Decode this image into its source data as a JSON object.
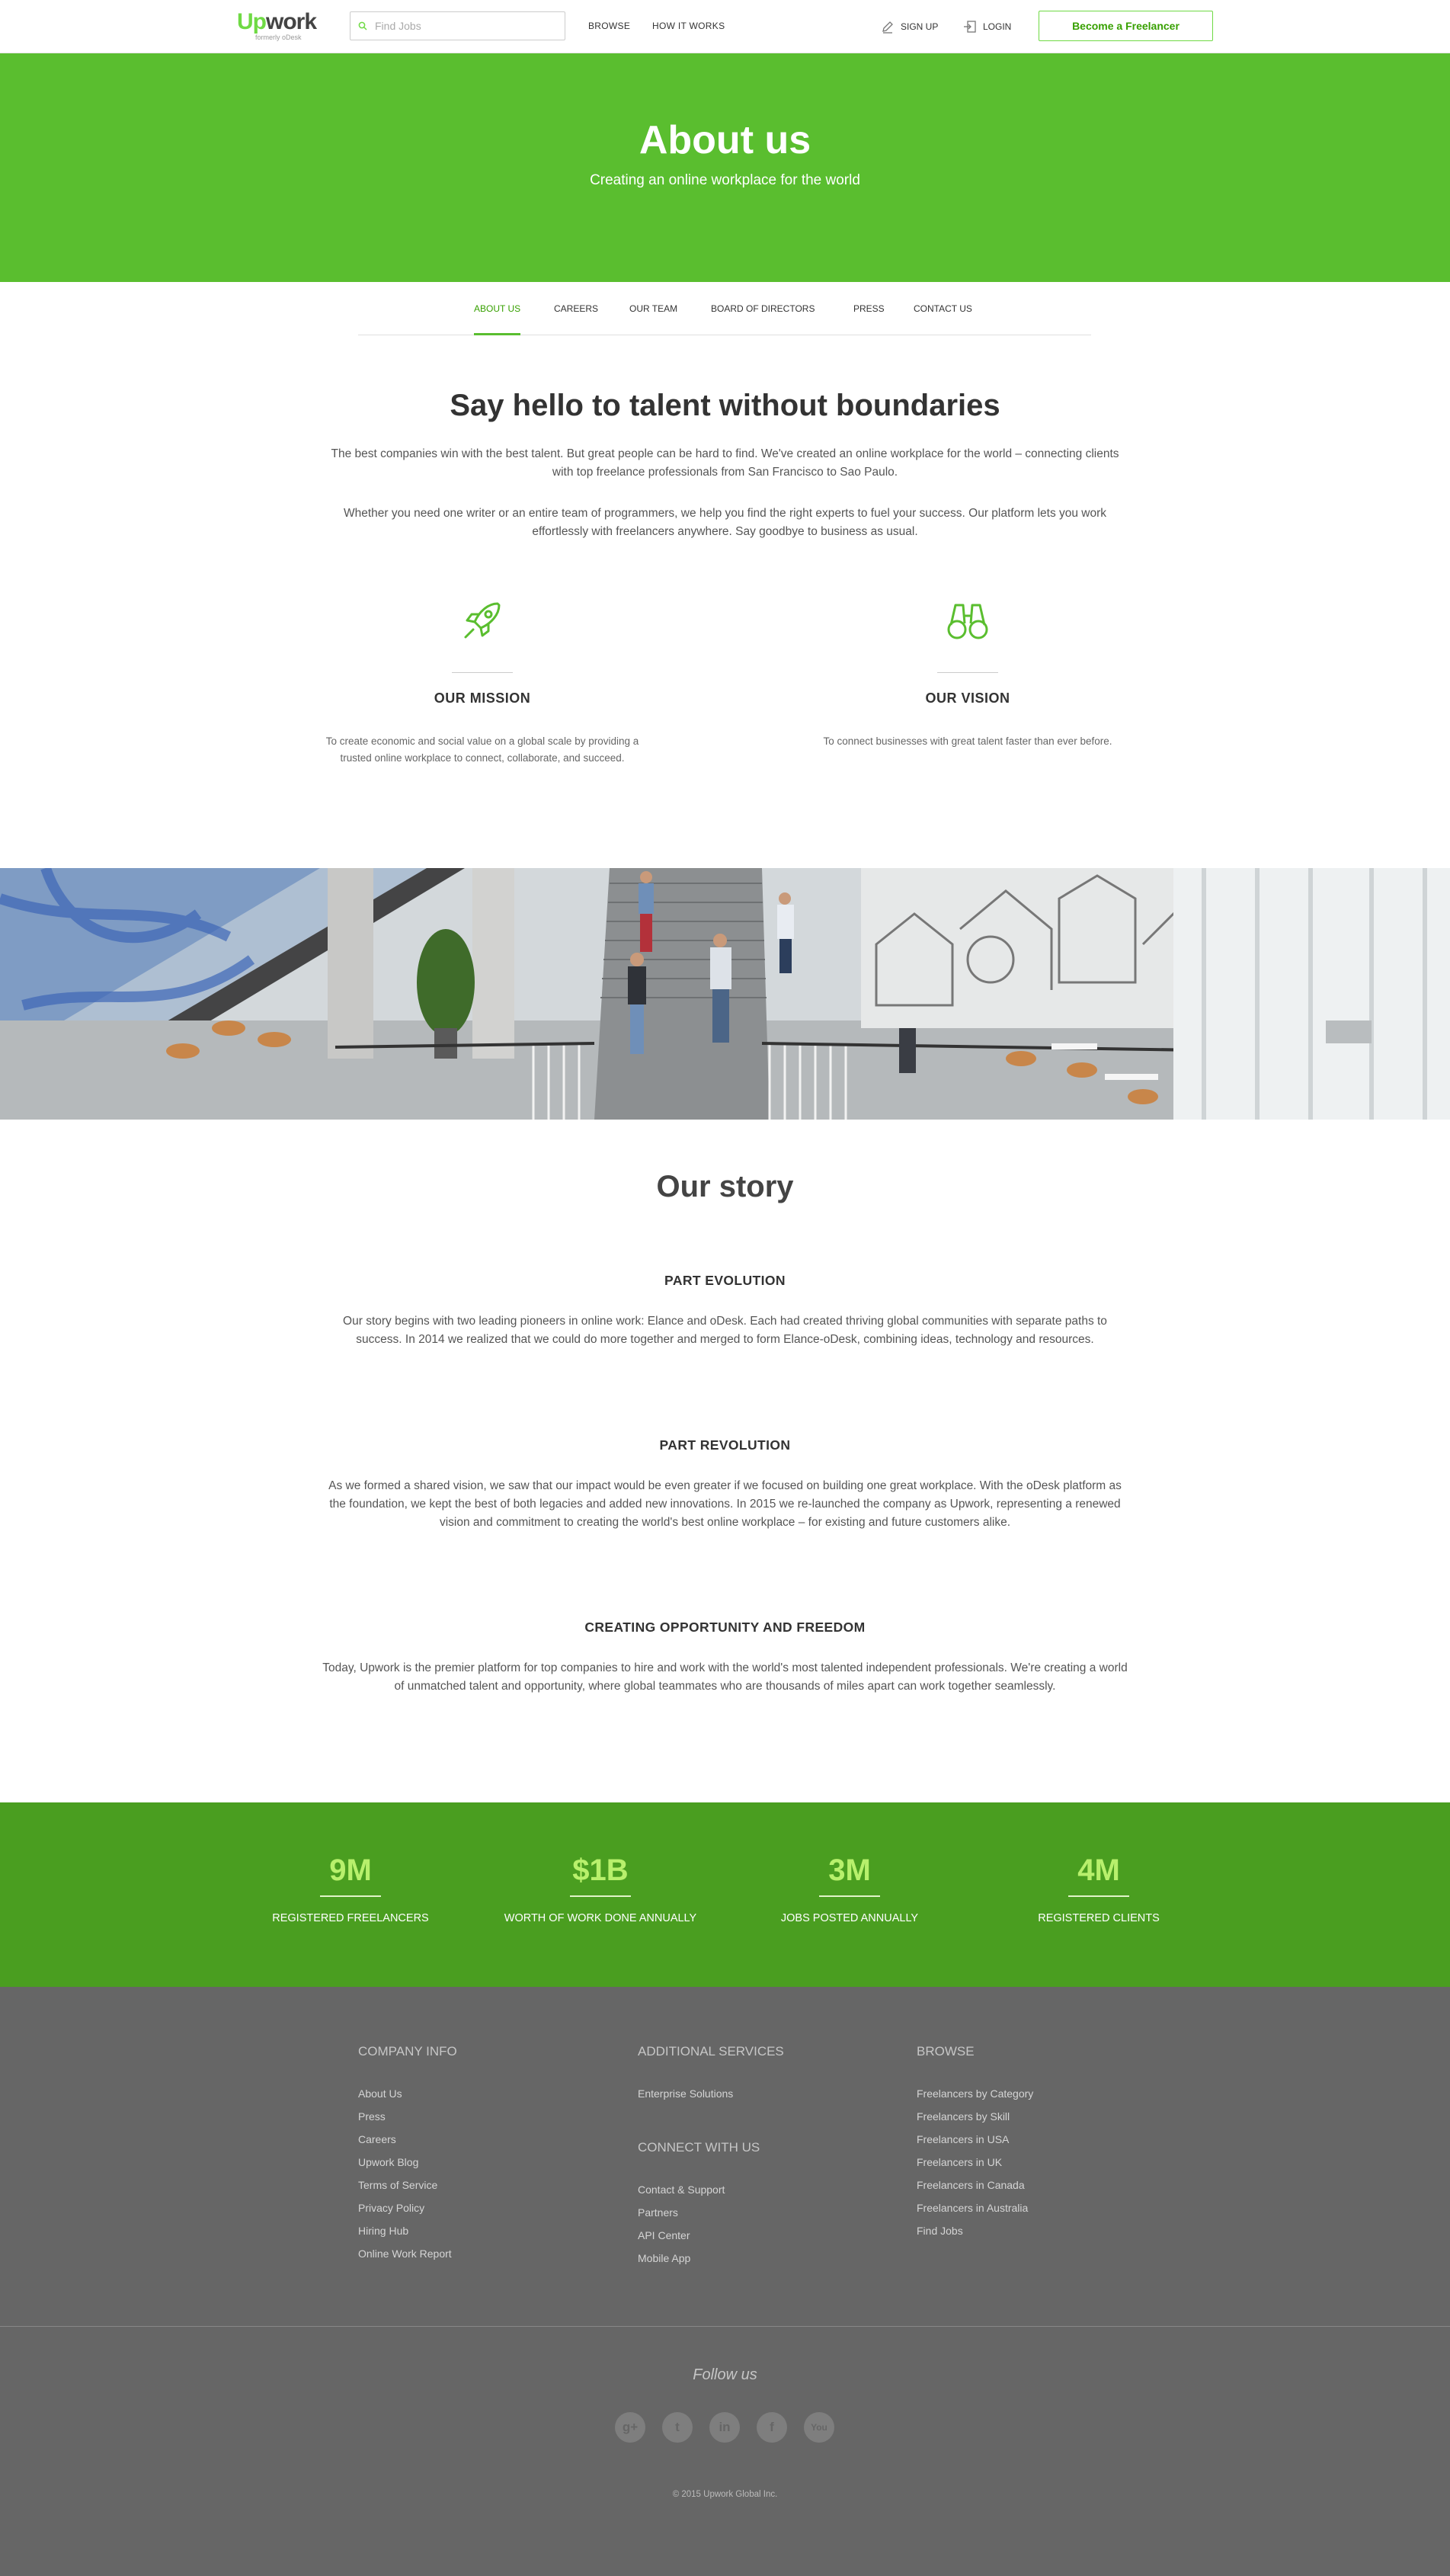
{
  "header": {
    "logo_text_up": "Up",
    "logo_text_work": "work",
    "logo_sub": "formerly oDesk",
    "search_placeholder": "Find Jobs",
    "nav": [
      "BROWSE",
      "HOW IT WORKS"
    ],
    "signup": "SIGN UP",
    "login": "LOGIN",
    "cta": "Become a Freelancer"
  },
  "hero": {
    "title": "About us",
    "subtitle": "Creating an online workplace for the world"
  },
  "subnav": [
    "ABOUT US",
    "CAREERS",
    "OUR TEAM",
    "BOARD OF DIRECTORS",
    "PRESS",
    "CONTACT US"
  ],
  "intro": {
    "title": "Say hello to talent without boundaries",
    "p1": "The best companies win with the best talent. But great people can be hard to find. We've created an online workplace for the world – connecting clients with top freelance professionals from San Francisco to Sao Paulo.",
    "p2": "Whether you need one writer or an entire team of programmers, we help you find the right experts to fuel your success. Our platform lets you work effortlessly with freelancers anywhere. Say goodbye to business as usual."
  },
  "mission": {
    "title": "OUR MISSION",
    "text": "To create economic and social value on a global scale by providing a trusted online workplace to connect, collaborate, and succeed."
  },
  "vision": {
    "title": "OUR VISION",
    "text": "To connect businesses with great talent faster than ever before."
  },
  "story": {
    "title": "Our story",
    "sections": [
      {
        "heading": "PART EVOLUTION",
        "text": "Our story begins with two leading pioneers in online work: Elance and oDesk. Each had created thriving global communities with separate paths to success. In 2014 we realized that we could do more together and merged to form Elance-oDesk, combining ideas, technology and resources."
      },
      {
        "heading": "PART REVOLUTION",
        "text": "As we formed a shared vision, we saw that our impact would be even greater if we focused on building one great workplace. With the oDesk platform as the foundation, we kept the best of both legacies and added new innovations. In 2015 we re-launched the company as Upwork, representing a renewed vision and commitment to creating the world's best online workplace – for existing and future customers alike."
      },
      {
        "heading": "CREATING OPPORTUNITY AND FREEDOM",
        "text": "Today, Upwork is the premier platform for top companies to hire and work with the world's most talented independent professionals. We're creating a world of unmatched talent and opportunity, where global teammates who are thousands of miles apart can work together seamlessly."
      }
    ]
  },
  "stats": [
    {
      "value": "9M",
      "label": "REGISTERED FREELANCERS"
    },
    {
      "value": "$1B",
      "label": "WORTH OF WORK DONE ANNUALLY"
    },
    {
      "value": "3M",
      "label": "JOBS POSTED ANNUALLY"
    },
    {
      "value": "4M",
      "label": "REGISTERED CLIENTS"
    }
  ],
  "footer": {
    "company_info": {
      "heading": "COMPANY INFO",
      "links": [
        "About Us",
        "Press",
        "Careers",
        "Upwork Blog",
        "Terms of Service",
        "Privacy Policy",
        "Hiring Hub",
        "Online Work Report"
      ]
    },
    "additional_services": {
      "heading": "ADDITIONAL SERVICES",
      "links": [
        "Enterprise Solutions"
      ]
    },
    "connect": {
      "heading": "CONNECT WITH US",
      "links": [
        "Contact & Support",
        "Partners",
        "API Center",
        "Mobile App"
      ]
    },
    "browse": {
      "heading": "BROWSE",
      "links": [
        "Freelancers by Category",
        "Freelancers by Skill",
        "Freelancers in USA",
        "Freelancers in UK",
        "Freelancers in Canada",
        "Freelancers in Australia",
        "Find Jobs"
      ]
    },
    "follow": "Follow us",
    "social": [
      {
        "name": "google-plus-icon",
        "glyph": "g+"
      },
      {
        "name": "twitter-icon",
        "glyph": "t"
      },
      {
        "name": "linkedin-icon",
        "glyph": "in"
      },
      {
        "name": "facebook-icon",
        "glyph": "f"
      },
      {
        "name": "youtube-icon",
        "glyph": "You"
      }
    ],
    "copyright": "© 2015 Upwork Global Inc."
  },
  "colors": {
    "brand_green": "#6fda44",
    "hero_green": "#5abe2f",
    "stats_green": "#4a9e20",
    "stat_number": "#b8f06c",
    "footer_bg": "#666666"
  }
}
